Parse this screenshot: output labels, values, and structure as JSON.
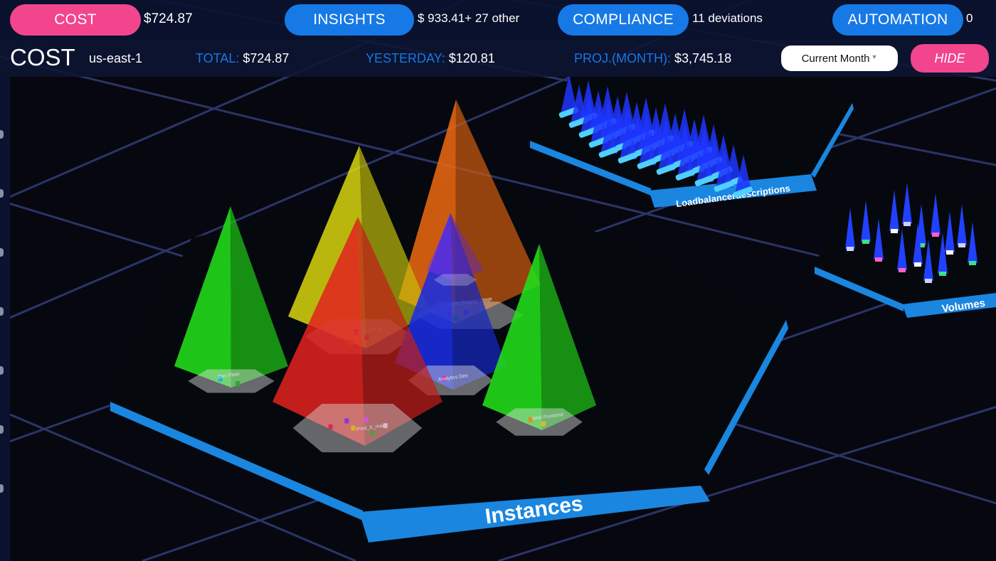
{
  "topbar": {
    "cost": {
      "label": "COST",
      "value": "$724.87"
    },
    "insights": {
      "label": "INSIGHTS",
      "value": "$ 933.41+ 27 other"
    },
    "compliance": {
      "label": "COMPLIANCE",
      "value": "11 deviations"
    },
    "automation": {
      "label": "AUTOMATION",
      "value": "0"
    }
  },
  "cost_bar": {
    "title": "COST",
    "region": "us-east-1",
    "total_label": "TOTAL:",
    "total_value": "$724.87",
    "yesterday_label": "YESTERDAY:",
    "yesterday_value": "$120.81",
    "projected_label": "PROJ.(MONTH):",
    "projected_value": "$3,745.18",
    "period_select": "Current Month",
    "hide_label": "HIDE"
  },
  "scene": {
    "platform_labels": {
      "instances": "Instances",
      "loadbalancers": "Loadbalancerdescriptions",
      "volumes": "Volumes"
    },
    "pyramid_labels": [
      "Dev Fleet",
      "Analytics Prod",
      "Prod_X_main",
      "Jupyter Staging Stage",
      "Analytics Dev",
      "Web Frontend"
    ],
    "colors": {
      "pink": "#f2458e",
      "blue": "#1679e6",
      "platform_edge": "#1a86e0",
      "green": "#22e01a",
      "yellow": "#e6e30f",
      "orange": "#f06a12",
      "red": "#e3231f",
      "purple": "#7a2fe8",
      "royal_blue": "#1a2de0"
    }
  }
}
